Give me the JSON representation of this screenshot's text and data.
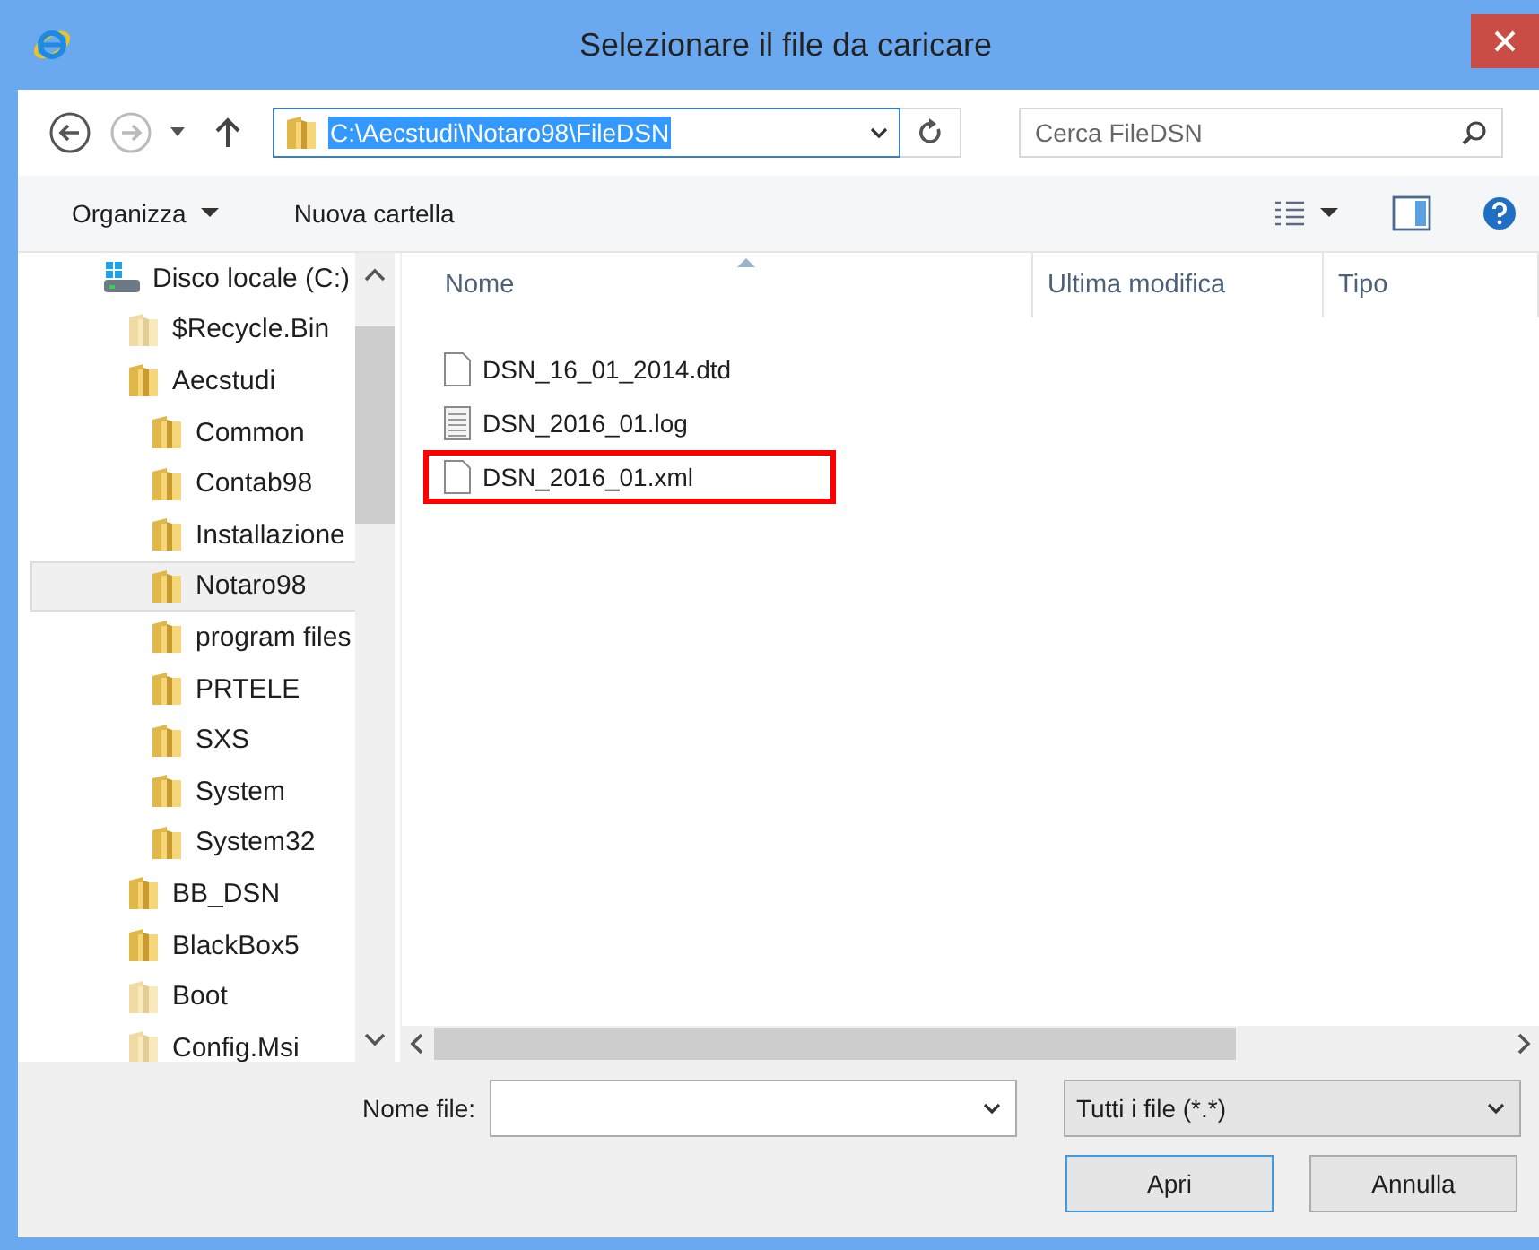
{
  "window": {
    "title": "Selezionare il file da caricare"
  },
  "address": {
    "path": "C:\\Aecstudi\\Notaro98\\FileDSN",
    "selected": true
  },
  "search": {
    "placeholder": "Cerca FileDSN"
  },
  "toolbar": {
    "organize": "Organizza",
    "new_folder": "Nuova cartella"
  },
  "tree": [
    {
      "label": "Disco locale (C:)",
      "kind": "drive",
      "selected": false,
      "children": [
        {
          "label": "$Recycle.Bin",
          "kind": "folder-faded",
          "selected": false
        },
        {
          "label": "Aecstudi",
          "kind": "folder",
          "selected": false,
          "children": [
            {
              "label": "Common",
              "kind": "folder",
              "selected": false
            },
            {
              "label": "Contab98",
              "kind": "folder",
              "selected": false
            },
            {
              "label": "Installazione",
              "kind": "folder",
              "selected": false
            },
            {
              "label": "Notaro98",
              "kind": "folder",
              "selected": true
            },
            {
              "label": "program files",
              "kind": "folder",
              "selected": false
            },
            {
              "label": "PRTELE",
              "kind": "folder",
              "selected": false
            },
            {
              "label": "SXS",
              "kind": "folder",
              "selected": false
            },
            {
              "label": "System",
              "kind": "folder",
              "selected": false
            },
            {
              "label": "System32",
              "kind": "folder",
              "selected": false
            }
          ]
        },
        {
          "label": "BB_DSN",
          "kind": "folder",
          "selected": false
        },
        {
          "label": "BlackBox5",
          "kind": "folder",
          "selected": false
        },
        {
          "label": "Boot",
          "kind": "folder-faded",
          "selected": false
        },
        {
          "label": "Config.Msi",
          "kind": "folder-faded",
          "selected": false
        }
      ]
    }
  ],
  "columns": [
    "Nome",
    "Ultima modifica",
    "Tipo"
  ],
  "files": [
    {
      "name": "DSN_16_01_2014.dtd",
      "kind": "blank",
      "highlighted": false
    },
    {
      "name": "DSN_2016_01.log",
      "kind": "text",
      "highlighted": false
    },
    {
      "name": "DSN_2016_01.xml",
      "kind": "blank",
      "highlighted": true
    }
  ],
  "filename": {
    "label": "Nome file:"
  },
  "filter": {
    "value": "Tutti i file (*.*)"
  },
  "buttons": [
    "Apri",
    "Annulla"
  ]
}
